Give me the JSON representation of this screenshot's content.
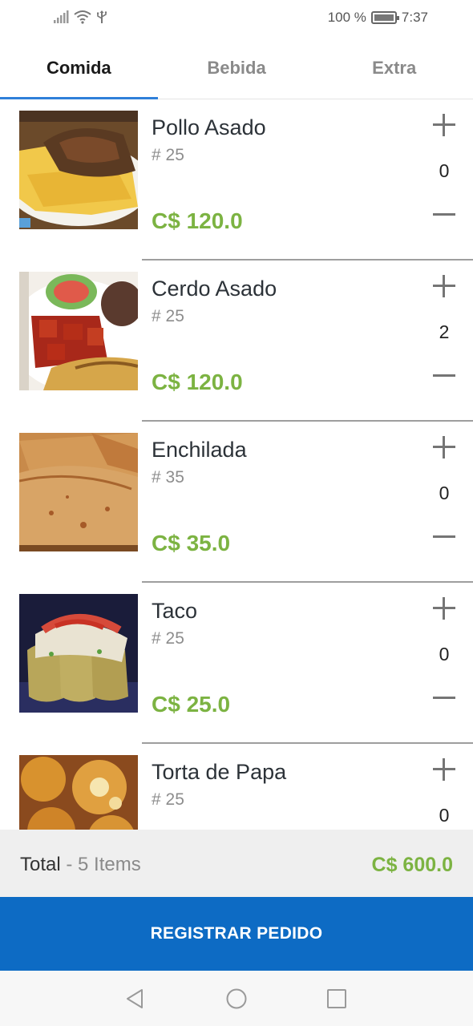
{
  "status_bar": {
    "battery_pct": "100 %",
    "time": "7:37",
    "icons": [
      "signal-icon",
      "wifi-icon",
      "usb-icon",
      "battery-icon"
    ]
  },
  "tabs": [
    {
      "label": "Comida",
      "active": true
    },
    {
      "label": "Bebida",
      "active": false
    },
    {
      "label": "Extra",
      "active": false
    }
  ],
  "items": [
    {
      "name": "Pollo Asado",
      "code": "# 25",
      "price": "C$ 120.0",
      "qty": "0"
    },
    {
      "name": "Cerdo Asado",
      "code": "# 25",
      "price": "C$ 120.0",
      "qty": "2"
    },
    {
      "name": "Enchilada",
      "code": "# 35",
      "price": "C$ 35.0",
      "qty": "0"
    },
    {
      "name": "Taco",
      "code": "# 25",
      "price": "C$ 25.0",
      "qty": "0"
    },
    {
      "name": "Torta de Papa",
      "code": "# 25",
      "price": "",
      "qty": "0"
    }
  ],
  "footer": {
    "total_label": "Total",
    "separator": " - ",
    "items_count": "5 Items",
    "total_amount": "C$ 600.0",
    "register_label": "REGISTRAR PEDIDO"
  },
  "colors": {
    "accent": "#2f80d9",
    "price_green": "#7cb342",
    "button_blue": "#0d6bc4"
  }
}
